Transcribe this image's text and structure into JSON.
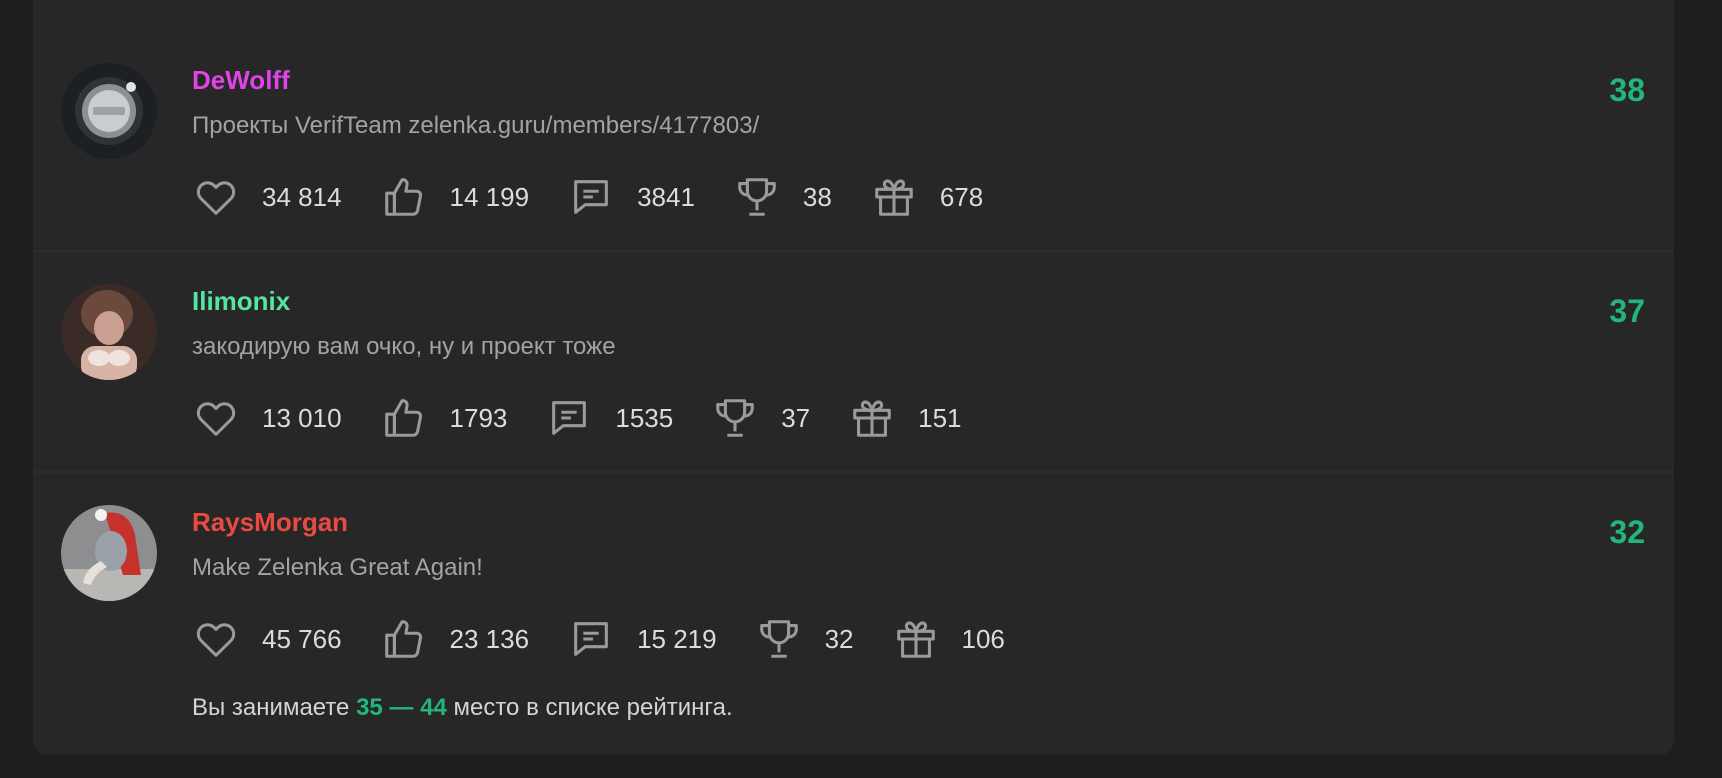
{
  "colors": {
    "rank": "#21b77a",
    "username_1": "#e044e6",
    "username_2": "#55e3a6",
    "username_3": "#e94b43",
    "icon": "#9a9a9a",
    "background": "#272727"
  },
  "users": [
    {
      "username": "DeWolff",
      "status": "Проекты VerifTeam zelenka.guru/members/4177803/",
      "rank": "38",
      "likes": "34 814",
      "sympathies": "14 199",
      "messages": "3841",
      "trophies": "38",
      "gifts": "678"
    },
    {
      "username": "Ilimonix",
      "status": "закодирую вам очко, ну и проект тоже",
      "rank": "37",
      "likes": "13 010",
      "sympathies": "1793",
      "messages": "1535",
      "trophies": "37",
      "gifts": "151"
    },
    {
      "username": "RaysMorgan",
      "status": "Make Zelenka Great Again!",
      "rank": "32",
      "likes": "45 766",
      "sympathies": "23 136",
      "messages": "15 219",
      "trophies": "32",
      "gifts": "106"
    }
  ],
  "footer": {
    "prefix": "Вы занимаете",
    "range": "35 — 44",
    "suffix": "место в списке рейтинга."
  },
  "icons": [
    "heart-icon",
    "thumbs-up-icon",
    "message-icon",
    "trophy-icon",
    "gift-icon"
  ]
}
